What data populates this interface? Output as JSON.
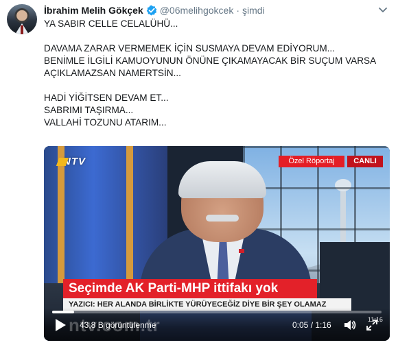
{
  "tweet": {
    "author_name": "İbrahim Melih Gökçek",
    "handle": "@06melihgokcek",
    "separator": "·",
    "time": "şimdi",
    "lines": [
      "YA SABIR CELLE CELALÜHÜ...",
      "",
      "DAVAMA ZARAR VERMEMEK İÇİN SUSMAYA DEVAM EDİYORUM...",
      "BENİMLE İLGİLİ KAMUOYUNUN ÖNÜNE ÇIKAMAYACAK BİR SUÇUM VARSA",
      "AÇIKLAMAZSAN NAMERTSİN...",
      "",
      "HADİ YİĞİTSEN DEVAM ET...",
      "SABRIMI TAŞIRMA...",
      "VALLAHİ TOZUNU ATARIM..."
    ]
  },
  "video": {
    "channel_logo": "NTV",
    "badge_report": "Özel Röportaj",
    "badge_live": "CANLI",
    "headline": "Seçimde AK Parti-MHP ittifakı yok",
    "subline": "YAZICI: HER ALANDA BİRLİKTE YÜRÜYECEĞİZ DİYE BİR ŞEY OLAMAZ",
    "watermark": "ntv.com.tr",
    "corner_clock": "11:16",
    "views": "43,8 B görüntülenme",
    "duration": "0:05 / 1:16",
    "progress_fraction": 0.066
  },
  "colors": {
    "verified_blue": "#1da1f2",
    "breaking_red": "#e32129",
    "muted_text": "#657786"
  },
  "icons": {
    "verified": "verified-badge-icon",
    "caret": "chevron-down-icon",
    "play": "play-icon",
    "volume": "volume-icon",
    "fullscreen": "fullscreen-icon"
  }
}
